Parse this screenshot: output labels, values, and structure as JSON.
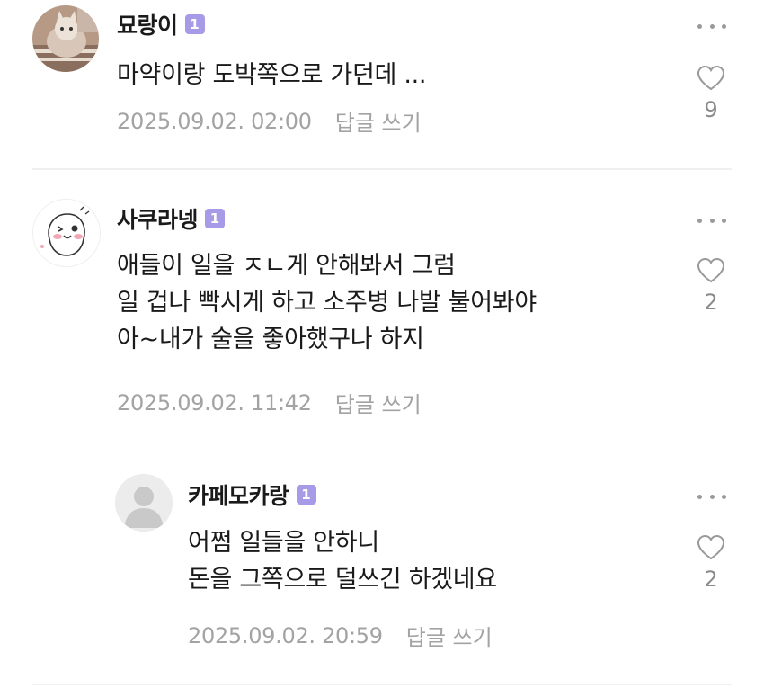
{
  "comments": [
    {
      "author": "묘랑이",
      "badge": "1",
      "lines": [
        "마약이랑 도박쪽으로 가던데 ..."
      ],
      "date": "2025.09.02. 02:00",
      "reply_label": "답글 쓰기",
      "likes": "9"
    },
    {
      "author": "사쿠라넹",
      "badge": "1",
      "lines": [
        "애들이 일을 ㅈㄴ게 안해봐서 그럼",
        "일 겁나 빡시게 하고 소주병 나발 불어봐야",
        "아~내가 술을 좋아했구나 하지"
      ],
      "date": "2025.09.02. 11:42",
      "reply_label": "답글 쓰기",
      "likes": "2"
    },
    {
      "author": "카페모카랑",
      "badge": "1",
      "lines": [
        "어쩜 일들을 안하니",
        "돈을 그쪽으로 덜쓰긴 하겠네요"
      ],
      "date": "2025.09.02. 20:59",
      "reply_label": "답글 쓰기",
      "likes": "2"
    }
  ],
  "colors": {
    "badge": "#a79be8",
    "meta_text": "#a3a3a3",
    "divider": "#f0f0f0"
  },
  "icons": {
    "like": "heart-outline-icon",
    "more": "more-dots-icon",
    "default_avatar": "person-silhouette-icon"
  }
}
